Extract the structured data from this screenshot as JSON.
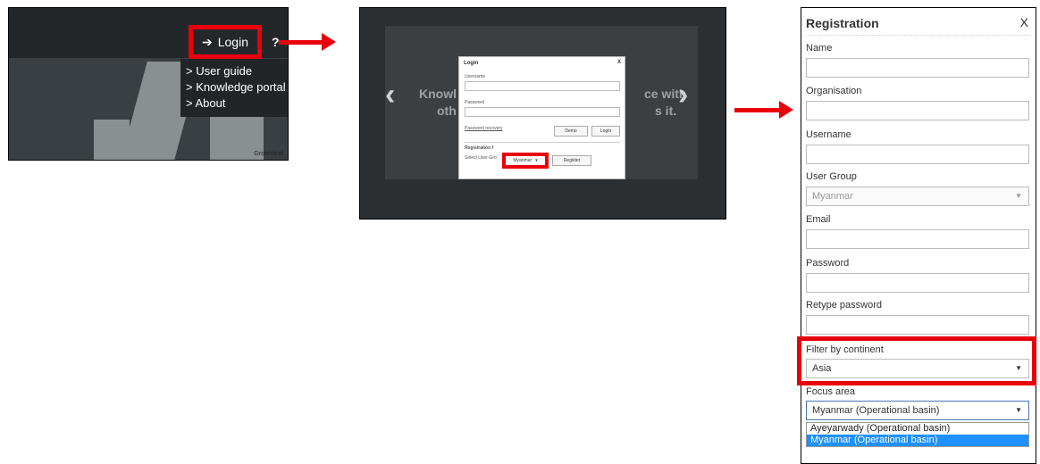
{
  "panel1": {
    "login_label": "Login",
    "help_label": "?",
    "menu_items": [
      "> User guide",
      "> Knowledge portal",
      "> About"
    ],
    "map_label": "Groenland"
  },
  "panel2": {
    "ghost_left": "Knowl",
    "ghost_right": "ce with",
    "ghost_left2": "oth",
    "ghost_right2": "s it.",
    "dialog": {
      "title": "Login",
      "close": "X",
      "username_label": "Username",
      "password_label": "Password",
      "password_recovery": "Password recovery",
      "demo_button": "Demo",
      "login_button": "Login",
      "registration_label": "Registration f",
      "select_group_label": "Select User-Gro",
      "group_value": "Myanmar",
      "register_button": "Register"
    }
  },
  "panel3": {
    "title": "Registration",
    "close": "X",
    "labels": {
      "name": "Name",
      "organisation": "Organisation",
      "username": "Username",
      "user_group": "User Group",
      "email": "Email",
      "password": "Password",
      "retype": "Retype password",
      "continent": "Filter by continent",
      "focus": "Focus area"
    },
    "user_group_value": "Myanmar",
    "continent_value": "Asia",
    "focus_value": "Myanmar (Operational basin)",
    "focus_options": [
      "Ayeyarwady (Operational basin)",
      "Myanmar (Operational basin)"
    ]
  },
  "colors": {
    "highlight": "#e8000b",
    "selected_option": "#1e90ff"
  }
}
